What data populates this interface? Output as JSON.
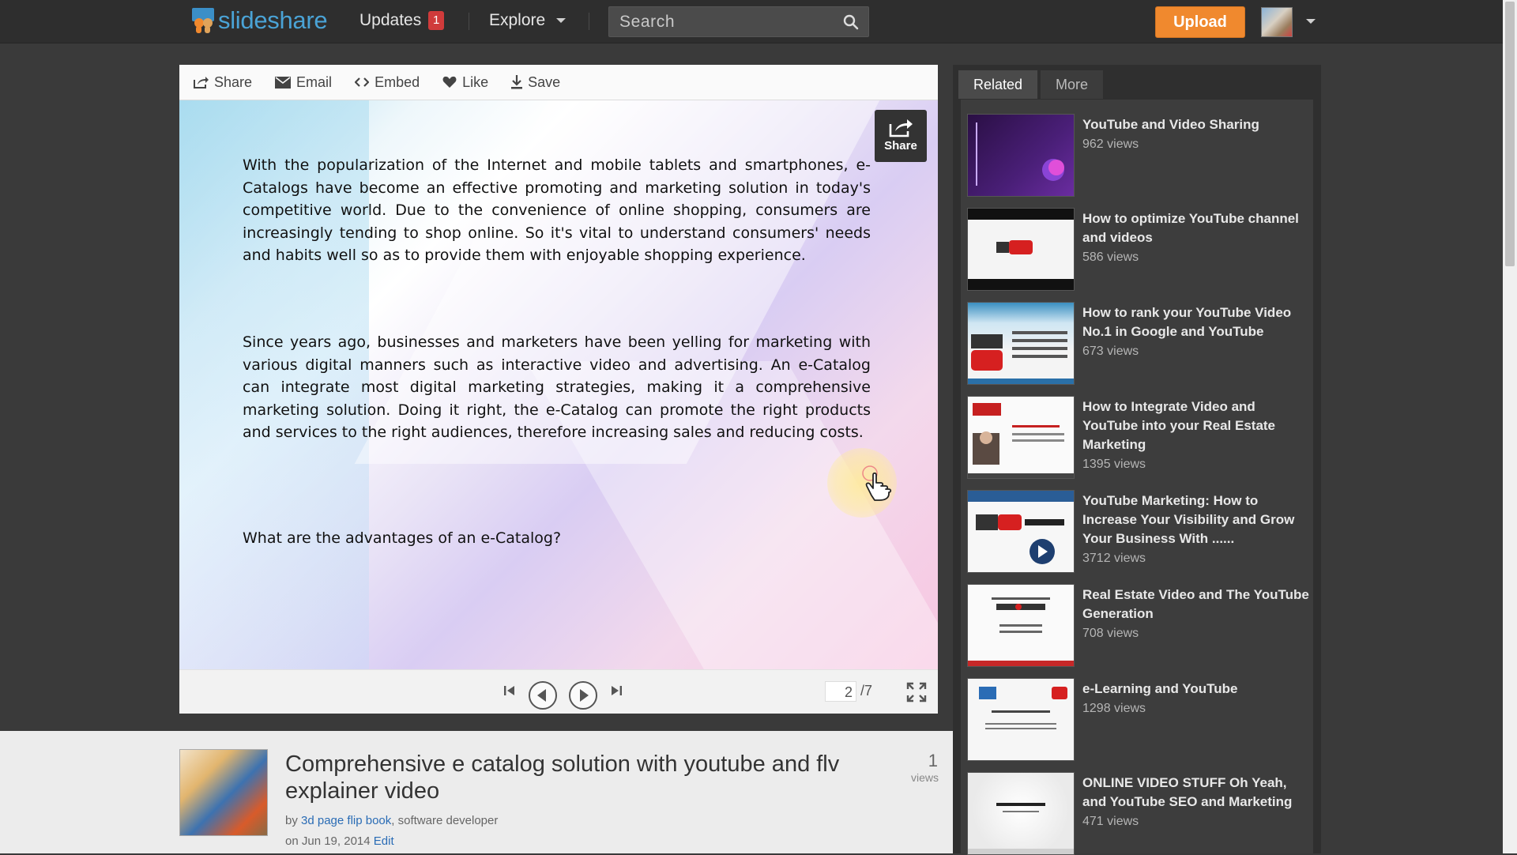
{
  "header": {
    "logo_text": "slideshare",
    "updates_label": "Updates",
    "updates_count": "1",
    "explore_label": "Explore",
    "search_placeholder": "Search",
    "upload_label": "Upload",
    "accent_color": "#f0892e",
    "brand_color": "#4aa3d6"
  },
  "toolbar": {
    "share": "Share",
    "email": "Email",
    "embed": "Embed",
    "like": "Like",
    "save": "Save"
  },
  "slide": {
    "paragraph1": "With the popularization of the Internet and mobile tablets and smartphones, e-Catalogs have become an effective promoting and marketing solution in today's competitive world. Due to the convenience of online shopping, consumers are increasingly tending to shop online. So it's vital to understand consumers' needs and habits well so as to provide them with enjoyable shopping experience.",
    "paragraph2": "Since years ago, businesses and marketers have been yelling for marketing with various digital manners such as interactive video and advertising. An e-Catalog can integrate most digital marketing strategies, making it a comprehensive marketing solution. Doing it right, the e-Catalog can promote the right products and services to the right audiences, therefore increasing sales and reducing costs.",
    "paragraph3": "What are the advantages of an e-Catalog?",
    "share_overlay": "Share"
  },
  "controls": {
    "current_page": "2",
    "total_pages": "/7"
  },
  "info": {
    "title": "Comprehensive e catalog solution with youtube and flv explainer video",
    "by_prefix": "by",
    "author": "3d page flip book",
    "author_suffix": ", software developer",
    "date": "on Jun 19, 2014",
    "edit": "Edit",
    "views_count": "1",
    "views_label": "views"
  },
  "sidebar": {
    "tabs": [
      "Related",
      "More"
    ],
    "items": [
      {
        "title": "YouTube and Video Sharing",
        "views": "962 views",
        "icon": "purple-slide-thumbnail"
      },
      {
        "title": "How to optimize YouTube channel and videos",
        "views": "586 views",
        "icon": "youtube-logo-thumbnail"
      },
      {
        "title": "How to rank your YouTube Video No.1 in Google and YouTube",
        "views": "673 views",
        "icon": "youtube-guide-thumbnail"
      },
      {
        "title": "How to Integrate Video and YouTube into your Real Estate Marketing",
        "views": "1395 views",
        "icon": "real-estate-thumbnail"
      },
      {
        "title": "YouTube Marketing: How to Increase Your Visibility and Grow Your Business With ......",
        "views": "3712 views",
        "icon": "youtube-marketing-thumbnail"
      },
      {
        "title": "Real Estate Video and The YouTube Generation",
        "views": "708 views",
        "icon": "real-estate-video-thumbnail"
      },
      {
        "title": "e-Learning and YouTube",
        "views": "1298 views",
        "icon": "elearning-thumbnail"
      },
      {
        "title": "ONLINE VIDEO STUFF Oh Yeah, and YouTube SEO and Marketing",
        "views": "471 views",
        "icon": "online-video-thumbnail"
      }
    ]
  }
}
